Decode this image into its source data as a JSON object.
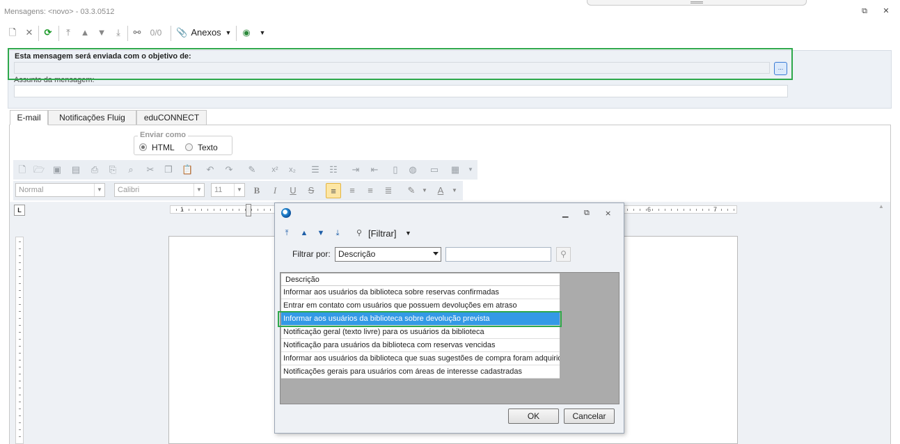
{
  "window": {
    "title": "Mensagens: <novo> - 03.3.0512"
  },
  "toolbar": {
    "counter": "0/0",
    "attachments_label": "Anexos"
  },
  "form": {
    "objective_label": "Esta mensagem será enviada com o objetivo de:",
    "objective_value": "",
    "browse_label": "...",
    "subject_label": "Assunto da mensagem:",
    "subject_value": ""
  },
  "tabs": [
    {
      "label": "E-mail"
    },
    {
      "label": "Notificações Fluig"
    },
    {
      "label": "eduCONNECT"
    }
  ],
  "send_as": {
    "title": "Enviar como",
    "options": [
      "HTML",
      "Texto"
    ],
    "selected": "HTML"
  },
  "editor": {
    "style": "Normal",
    "font": "Calibri",
    "size": "11"
  },
  "ruler": {
    "marks": [
      "1",
      "6",
      "7"
    ]
  },
  "dialog": {
    "filter_button": "[Filtrar]",
    "filter_by_label": "Filtrar por:",
    "filter_by_value": "Descrição",
    "filter_text": "",
    "column_header": "Descrição",
    "rows": [
      "Informar aos usuários da biblioteca sobre reservas confirmadas",
      "Entrar em contato com usuários que possuem devoluções em atraso",
      "Informar aos usuários da biblioteca sobre devolução prevista",
      "Notificação geral (texto livre) para os usuários da biblioteca",
      "Notificação para usuários da biblioteca com reservas vencidas",
      "Informar aos usuários da biblioteca que suas sugestões de compra foram adquiridas",
      "Notificações gerais para usuários com áreas de interesse cadastradas"
    ],
    "selected_index": 2,
    "ok_label": "OK",
    "cancel_label": "Cancelar"
  },
  "colors": {
    "highlight": "#2ea84b",
    "selection": "#3399e6"
  }
}
